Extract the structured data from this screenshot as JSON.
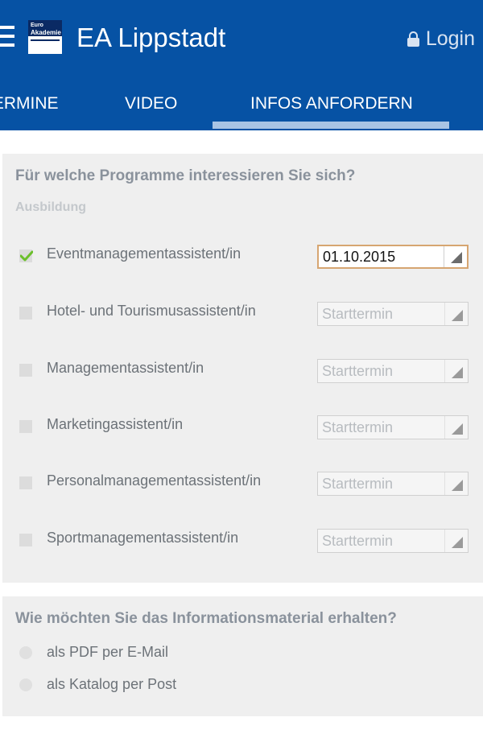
{
  "header": {
    "title": "EA Lippstadt",
    "login_label": "Login",
    "logo": {
      "line1": "Euro",
      "line2": "Akademie"
    },
    "background_color": "#0652a4"
  },
  "tabs": [
    {
      "label": "TERMINE"
    },
    {
      "label": "VIDEO"
    },
    {
      "label": "INFOS ANFORDERN",
      "active": true
    }
  ],
  "programs": {
    "heading": "Für welche Programme interessieren Sie sich?",
    "category": "Ausbildung",
    "items": [
      {
        "label": "Eventmanagementassistent/in",
        "checked": true,
        "start": "01.10.2015"
      },
      {
        "label": "Hotel- und Tourismusassistent/in",
        "checked": false,
        "start": "Starttermin"
      },
      {
        "label": "Managementassistent/in",
        "checked": false,
        "start": "Starttermin"
      },
      {
        "label": "Marketingassistent/in",
        "checked": false,
        "start": "Starttermin"
      },
      {
        "label": "Personalmanagementassistent/in",
        "checked": false,
        "start": "Starttermin"
      },
      {
        "label": "Sportmanagementassistent/in",
        "checked": false,
        "start": "Starttermin"
      }
    ]
  },
  "delivery": {
    "heading": "Wie möchten Sie das Informationsmaterial erhalten?",
    "options": [
      {
        "label": "als PDF per E-Mail",
        "selected": false
      },
      {
        "label": "als Katalog per Post",
        "selected": false
      }
    ]
  },
  "icons": {
    "menu": "hamburger-icon",
    "lock": "lock-icon",
    "check": "checkmark-icon",
    "dropdown": "dropdown-triangle-icon"
  },
  "colors": {
    "check_green": "#6bbf2b",
    "active_border": "#d6a571"
  }
}
